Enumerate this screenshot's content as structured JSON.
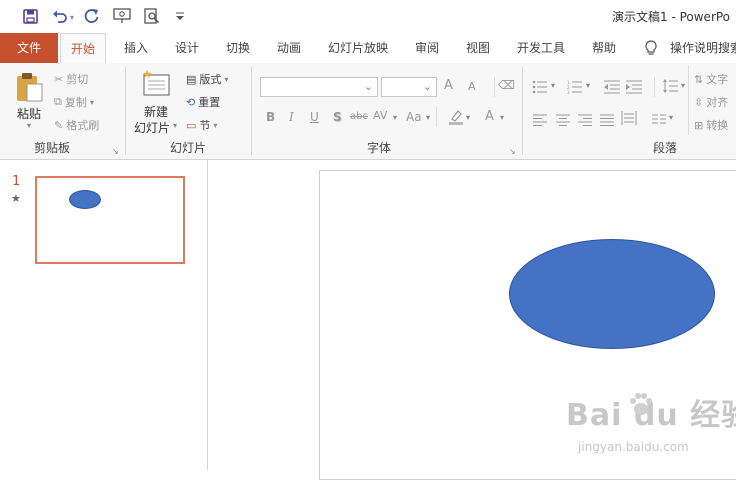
{
  "window": {
    "title": "演示文稿1  -  PowerPo"
  },
  "qat": {
    "icons": [
      "save-icon",
      "undo-icon",
      "redo-icon",
      "present-icon",
      "preview-icon",
      "customize-icon"
    ]
  },
  "tabs": [
    "文件",
    "开始",
    "插入",
    "设计",
    "切换",
    "动画",
    "幻灯片放映",
    "审阅",
    "视图",
    "开发工具",
    "帮助"
  ],
  "tell_me": "操作说明搜索",
  "clipboard": {
    "label": "剪贴板",
    "paste": "粘贴",
    "cut": "剪切",
    "copy": "复制",
    "format_painter": "格式刷"
  },
  "slides_group": {
    "label": "幻灯片",
    "new_slide_line1": "新建",
    "new_slide_line2": "幻灯片",
    "layout": "版式",
    "reset": "重置",
    "section": "节"
  },
  "font_group": {
    "label": "字体",
    "bold": "B",
    "italic": "I",
    "underline": "U",
    "shadow": "S",
    "strike": "abc",
    "spacing": "AV",
    "case": "Aa",
    "color": "A",
    "grow": "A",
    "shrink": "A"
  },
  "paragraph_group": {
    "label": "段落",
    "text_direction": "文字",
    "align_text": "对齐",
    "convert": "转换"
  },
  "slide_pane": {
    "slide_number": "1",
    "star": "★"
  },
  "colors": {
    "accent": "#c6502e",
    "shape_fill": "#4472c4",
    "shape_outline": "#2f5597"
  },
  "watermark": {
    "text": "Bai du 经验",
    "url": "jingyan.baidu.com"
  }
}
